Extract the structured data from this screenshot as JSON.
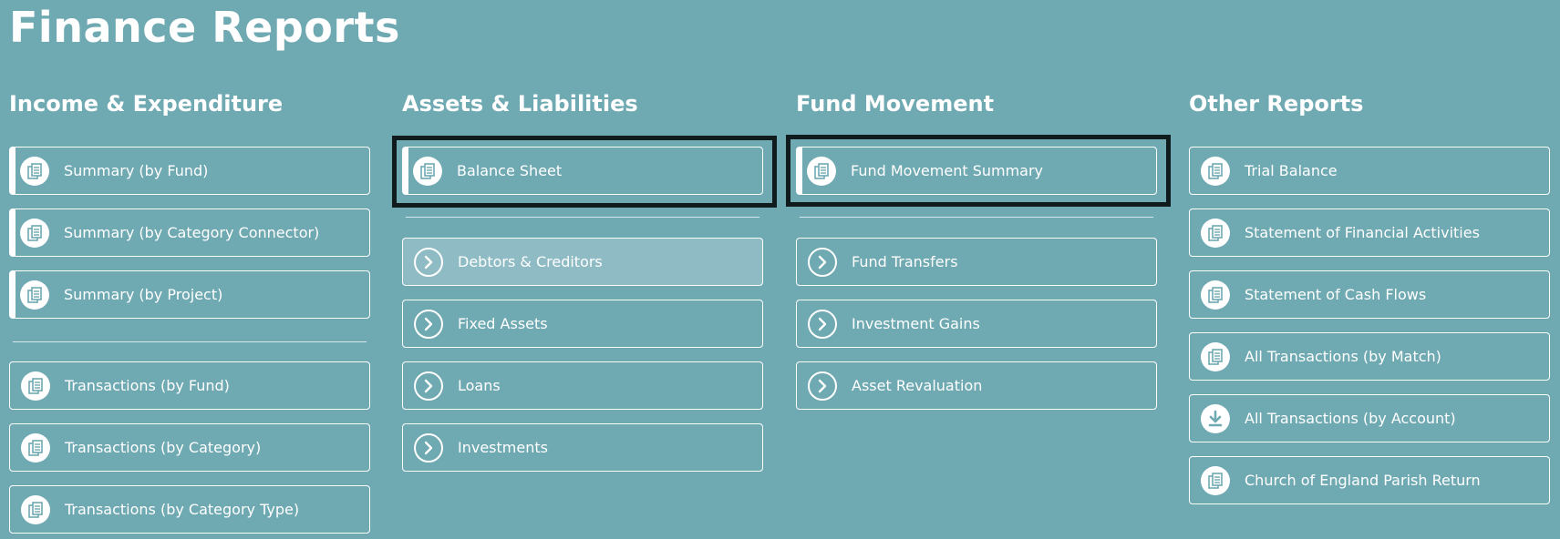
{
  "page": {
    "title": "Finance Reports"
  },
  "colors": {
    "background": "#6fa9b2",
    "hover_background": "#8fbcc4",
    "icon_glyph": "#6fa9b2",
    "text": "#ffffff",
    "highlight_border": "#0f1b1d"
  },
  "columns": [
    {
      "title": "Income & Expenditure",
      "items": [
        {
          "label": "Summary (by Fund)",
          "icon": "report-document-icon"
        },
        {
          "label": "Summary (by Category Connector)",
          "icon": "report-document-icon"
        },
        {
          "label": "Summary (by Project)",
          "icon": "report-document-icon"
        },
        {
          "label": "Transactions (by Fund)",
          "icon": "report-document-icon"
        },
        {
          "label": "Transactions (by Category)",
          "icon": "report-document-icon"
        },
        {
          "label": "Transactions (by Category Type)",
          "icon": "report-document-icon"
        }
      ]
    },
    {
      "title": "Assets & Liabilities",
      "items": [
        {
          "label": "Balance Sheet",
          "icon": "report-document-icon"
        },
        {
          "label": "Debtors & Creditors",
          "icon": "chevron-right-icon"
        },
        {
          "label": "Fixed Assets",
          "icon": "chevron-right-icon"
        },
        {
          "label": "Loans",
          "icon": "chevron-right-icon"
        },
        {
          "label": "Investments",
          "icon": "chevron-right-icon"
        }
      ]
    },
    {
      "title": "Fund Movement",
      "items": [
        {
          "label": "Fund Movement Summary",
          "icon": "report-document-icon"
        },
        {
          "label": "Fund Transfers",
          "icon": "chevron-right-icon"
        },
        {
          "label": "Investment Gains",
          "icon": "chevron-right-icon"
        },
        {
          "label": "Asset Revaluation",
          "icon": "chevron-right-icon"
        }
      ]
    },
    {
      "title": "Other Reports",
      "items": [
        {
          "label": "Trial Balance",
          "icon": "report-document-icon"
        },
        {
          "label": "Statement of Financial Activities",
          "icon": "report-document-icon"
        },
        {
          "label": "Statement of Cash Flows",
          "icon": "report-document-icon"
        },
        {
          "label": "All Transactions (by Match)",
          "icon": "report-document-icon"
        },
        {
          "label": "All Transactions (by Account)",
          "icon": "download-icon"
        },
        {
          "label": "Church of England Parish Return",
          "icon": "report-document-icon"
        }
      ]
    }
  ]
}
